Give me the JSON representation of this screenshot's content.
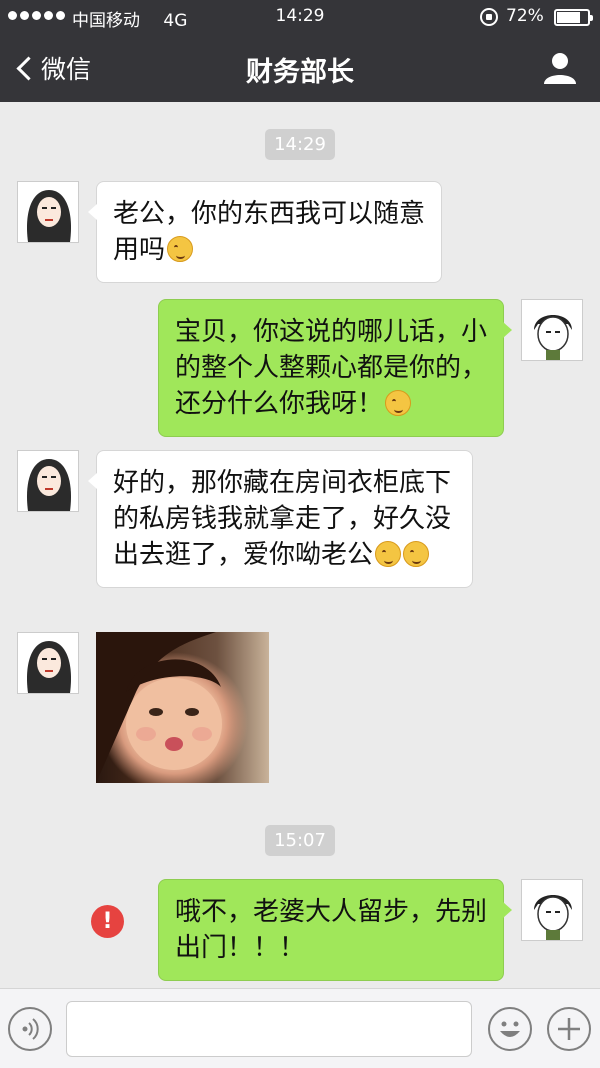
{
  "status_bar": {
    "carrier": "中国移动",
    "network": "4G",
    "time": "14:29",
    "battery": "72%",
    "battery_level": 0.72
  },
  "nav": {
    "back_label": "微信",
    "title": "财务部长",
    "profile_icon": "person-icon"
  },
  "messages": [
    {
      "type": "timestamp",
      "text": "14:29"
    },
    {
      "type": "text",
      "side": "in",
      "text": "老公，你的东西我可以随意用吗",
      "emoji": "smile-emoji"
    },
    {
      "type": "text",
      "side": "out",
      "text": "宝贝，你这说的哪儿话，小的整个人整颗心都是你的，还分什么你我呀！",
      "emoji": "heart-eyes-emoji"
    },
    {
      "type": "text",
      "side": "in",
      "text": "好的，那你藏在房间衣柜底下的私房钱我就拿走了，好久没出去逛了，爱你呦老公",
      "emoji": "kiss-emoji"
    },
    {
      "type": "image",
      "side": "in",
      "image": "photo-pouting-girl"
    },
    {
      "type": "timestamp",
      "text": "15:07"
    },
    {
      "type": "text",
      "side": "out",
      "text": "哦不，老婆大人留步，先别出门！！！",
      "status": "send-failed",
      "badge": "!"
    }
  ],
  "input_bar": {
    "voice_icon": "voice-icon",
    "placeholder": "",
    "emoji_icon": "emoji-icon",
    "plus_icon": "plus-icon"
  },
  "colors": {
    "nav_bg": "#353539",
    "chat_bg": "#ebebeb",
    "outgoing_bubble": "#a0e75a",
    "incoming_bubble": "#ffffff",
    "error_badge": "#e64340"
  }
}
